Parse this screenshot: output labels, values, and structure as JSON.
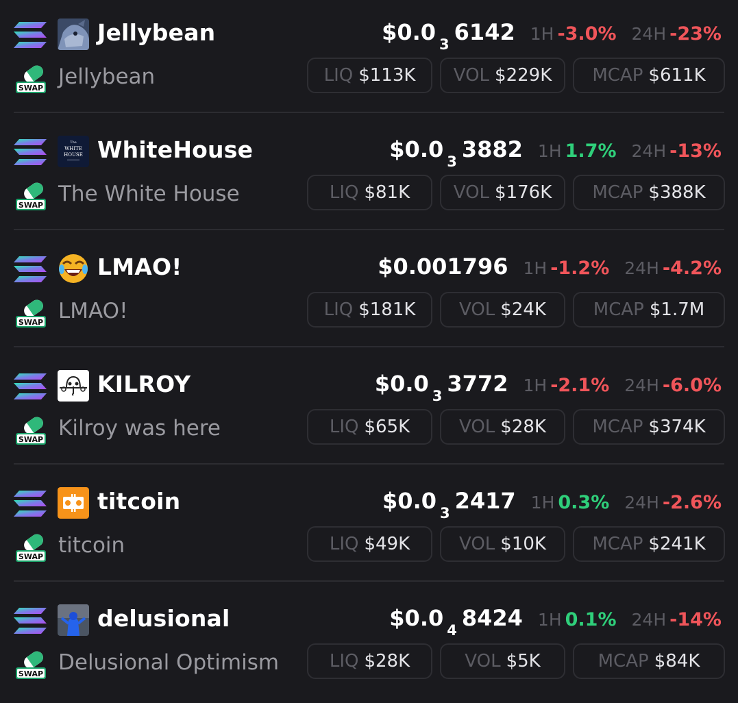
{
  "labels": {
    "h1": "1H",
    "h24": "24H",
    "liq": "LIQ",
    "vol": "VOL",
    "mcap": "MCAP",
    "dex_badge": "SWAP"
  },
  "colors": {
    "background": "#1a1a1e",
    "negative": "#f0555a",
    "positive": "#2fcf7a",
    "muted": "#5c5c63"
  },
  "tokens": [
    {
      "symbol": "Jellybean",
      "name": "Jellybean",
      "price_prefix": "$0.0",
      "price_zeros": "3",
      "price_digits": "6142",
      "change_1h": "-3.0%",
      "change_1h_dir": "neg",
      "change_24h": "-23%",
      "change_24h_dir": "neg",
      "liq": "$113K",
      "vol": "$229K",
      "mcap": "$611K",
      "icon": "jellybean-avatar-icon"
    },
    {
      "symbol": "WhiteHouse",
      "name": "The White House",
      "price_prefix": "$0.0",
      "price_zeros": "3",
      "price_digits": "3882",
      "change_1h": "1.7%",
      "change_1h_dir": "pos",
      "change_24h": "-13%",
      "change_24h_dir": "neg",
      "liq": "$81K",
      "vol": "$176K",
      "mcap": "$388K",
      "icon": "whitehouse-logo-icon",
      "icon_text": [
        "The",
        "WHITE",
        "HOUSE"
      ]
    },
    {
      "symbol": "LMAO!",
      "name": "LMAO!",
      "price_prefix": "$0.001796",
      "price_zeros": "",
      "price_digits": "",
      "change_1h": "-1.2%",
      "change_1h_dir": "neg",
      "change_24h": "-4.2%",
      "change_24h_dir": "neg",
      "liq": "$181K",
      "vol": "$24K",
      "mcap": "$1.7M",
      "icon": "laughing-emoji-icon"
    },
    {
      "symbol": "KILROY",
      "name": "Kilroy was here",
      "price_prefix": "$0.0",
      "price_zeros": "3",
      "price_digits": "3772",
      "change_1h": "-2.1%",
      "change_1h_dir": "neg",
      "change_24h": "-6.0%",
      "change_24h_dir": "neg",
      "liq": "$65K",
      "vol": "$28K",
      "mcap": "$374K",
      "icon": "kilroy-doodle-icon"
    },
    {
      "symbol": "titcoin",
      "name": "titcoin",
      "price_prefix": "$0.0",
      "price_zeros": "3",
      "price_digits": "2417",
      "change_1h": "0.3%",
      "change_1h_dir": "pos",
      "change_24h": "-2.6%",
      "change_24h_dir": "neg",
      "liq": "$49K",
      "vol": "$10K",
      "mcap": "$241K",
      "icon": "titcoin-logo-icon"
    },
    {
      "symbol": "delusional",
      "name": "Delusional Optimism",
      "price_prefix": "$0.0",
      "price_zeros": "4",
      "price_digits": "8424",
      "change_1h": "0.1%",
      "change_1h_dir": "pos",
      "change_24h": "-14%",
      "change_24h_dir": "neg",
      "liq": "$28K",
      "vol": "$5K",
      "mcap": "$84K",
      "icon": "delusional-avatar-icon"
    }
  ]
}
